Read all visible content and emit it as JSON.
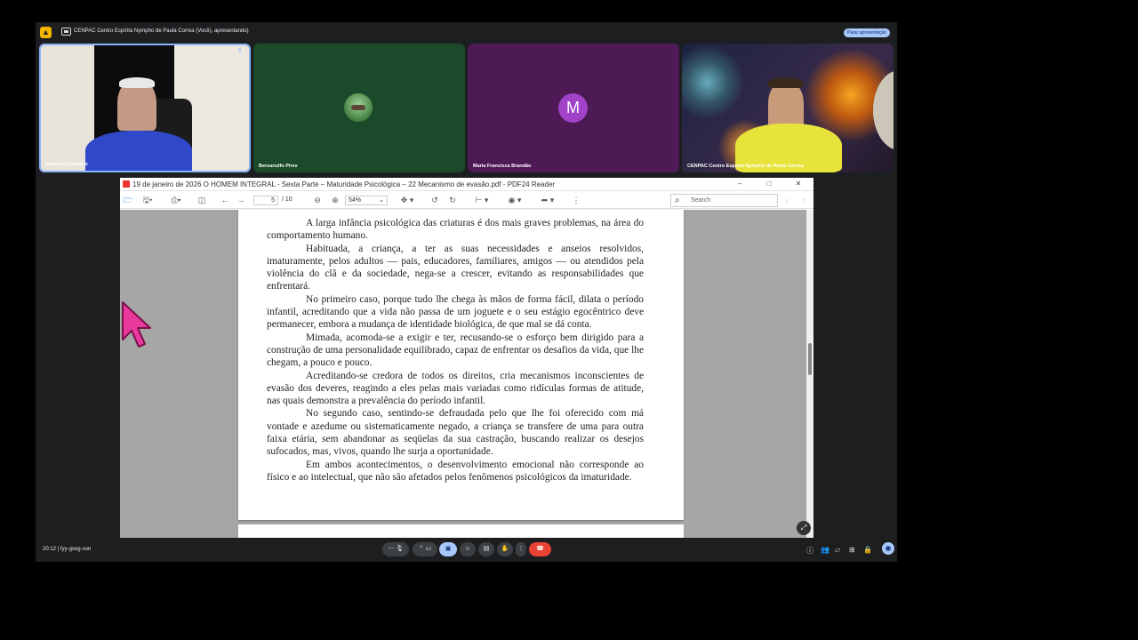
{
  "meet": {
    "lock_icon": "lock-icon",
    "title": "CENPAC Centro Espírita Nympho de Paula Correa (Você), apresentando)",
    "stop_presenting": "Parar apresentação",
    "time": "20:12",
    "meeting_code": "fyy-gxeg-xon",
    "accent_color": "#a8c7fa",
    "hangup_color": "#ea4335"
  },
  "participants": [
    {
      "name": "Mauricio Carneiro"
    },
    {
      "name": "Bersanulfo Pires"
    },
    {
      "name": "Maria Francisca Brandão",
      "initial": "M",
      "color": "#a142c9"
    },
    {
      "name": "CENPAC Centro Espírita Nympho de Paula Correa"
    }
  ],
  "viewer": {
    "window_title": "19 de janeiro de 2026 O HOMEM INTEGRAL -  Sexta Parte – Maturidade Psicológica –  22 Mecanismo de evasão.pdf - PDF24 Reader",
    "page_current": "5",
    "page_total": "/  10",
    "zoom": "54%",
    "search_placeholder": "Search",
    "paragraphs": [
      "A larga infância psicológica das criaturas é dos mais graves problemas, na área do comportamento humano.",
      "Habituada, a criança, a ter as suas necessidades e anseios resolvidos, imaturamente, pelos adultos — pais, educadores, familiares, amigos — ou atendidos pela violência do clã e da sociedade, nega-se a crescer, evitando as responsabilidades que enfrentará.",
      "No primeiro caso, porque tudo lhe chega às mãos de forma fácil, dilata o período infantil, acreditando que a vida não passa de um joguete e o seu estágio egocêntrico deve permanecer, embora a mudança de identidade biológica, de que mal se dá conta.",
      "Mimada, acomoda-se a exigir e ter, recusando-se o esforço bem dirigido para a construção de uma personalidade equilibrado, capaz de enfrentar os desafios da vida, que lhe chegam, a pouco e pouco.",
      "Acreditando-se credora de todos os direitos, cria mecanismos inconscientes de evasão dos deveres, reagindo a eles pelas mais variadas como ridículas formas de atitude, nas quais demonstra a prevalência do período infantil.",
      "No segundo caso, sentindo-se defraudada pelo que lhe foi oferecido com má vontade e azedume ou sistematicamente negado, a criança se transfere de uma para outra faixa etária, sem abandonar as seqüelas da sua castração, buscando realizar os desejos sufocados, mas, vivos, quando lhe surja a oportunidade.",
      "Em ambos acontecimentos, o desenvolvimento emocional não corresponde ao físico e ao intelectual, que não são afetados pelos fenômenos psicológicos da imaturidade."
    ]
  }
}
